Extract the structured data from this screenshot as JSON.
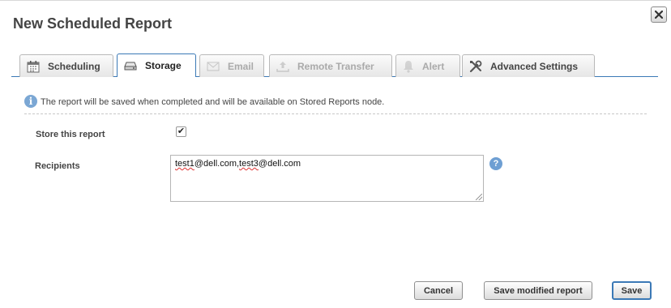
{
  "dialog": {
    "title": "New Scheduled Report"
  },
  "tabs": [
    {
      "label": "Scheduling",
      "icon": "calendar-icon",
      "state": "normal"
    },
    {
      "label": "Storage",
      "icon": "storage-drive-icon",
      "state": "active"
    },
    {
      "label": "Email",
      "icon": "envelope-icon",
      "state": "disabled"
    },
    {
      "label": "Remote Transfer",
      "icon": "upload-tray-icon",
      "state": "disabled"
    },
    {
      "label": "Alert",
      "icon": "bell-icon",
      "state": "disabled"
    },
    {
      "label": "Advanced Settings",
      "icon": "tools-icon",
      "state": "normal"
    }
  ],
  "storage": {
    "info": "The report will be saved when completed and will be available on Stored Reports node.",
    "store_label": "Store this report",
    "store_checked": true,
    "store_check_glyph": "✔",
    "recipients_label": "Recipients",
    "recipients_value": {
      "part1": "test1",
      "part2": "@dell.com,",
      "part3": "test3",
      "part4": "@dell.com"
    },
    "help_glyph": "?",
    "info_glyph": "i"
  },
  "buttons": {
    "cancel": "Cancel",
    "save_modified": "Save modified report",
    "save": "Save"
  },
  "colors": {
    "accent": "#3b79b6",
    "info_icon": "#7ba7d4",
    "help_icon": "#6e9fd3"
  }
}
